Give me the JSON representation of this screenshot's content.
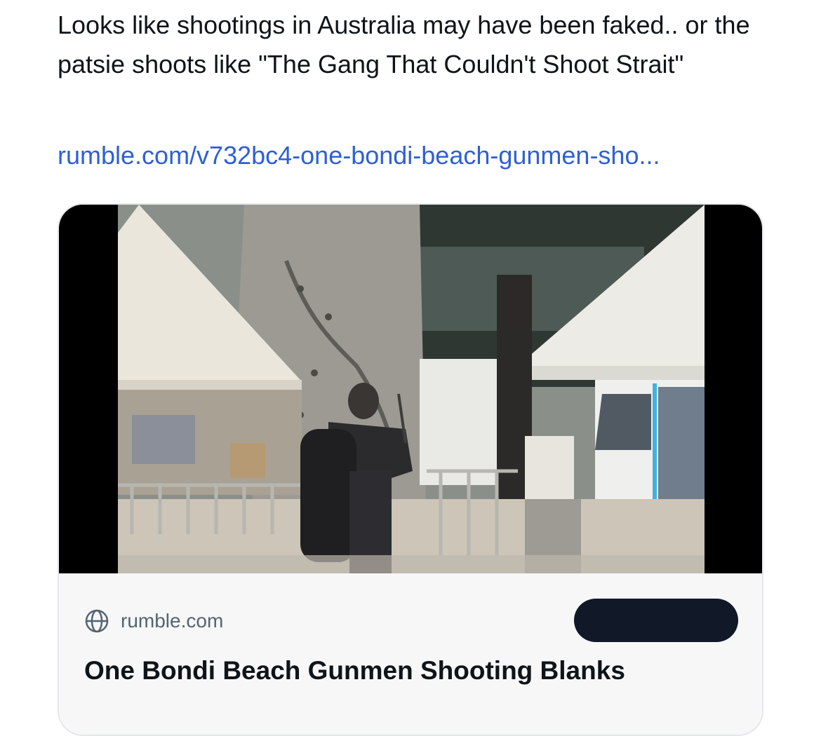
{
  "post": {
    "text": "Looks like shootings in Australia may have been faked.. or the patsie shoots like \"The Gang That Couldn't Shoot Strait\"",
    "link_text": "rumble.com/v732bc4-one-bondi-beach-gunmen-sho..."
  },
  "card": {
    "domain": "rumble.com",
    "title": "One Bondi Beach Gunmen Shooting Blanks",
    "domain_icon": "globe-icon",
    "thumbnail_icon": "video-thumbnail"
  },
  "colors": {
    "link": "#2f5fd6",
    "text": "#0f1419",
    "muted": "#536471",
    "card_bg": "#f7f7f8",
    "pill": "#111827"
  }
}
